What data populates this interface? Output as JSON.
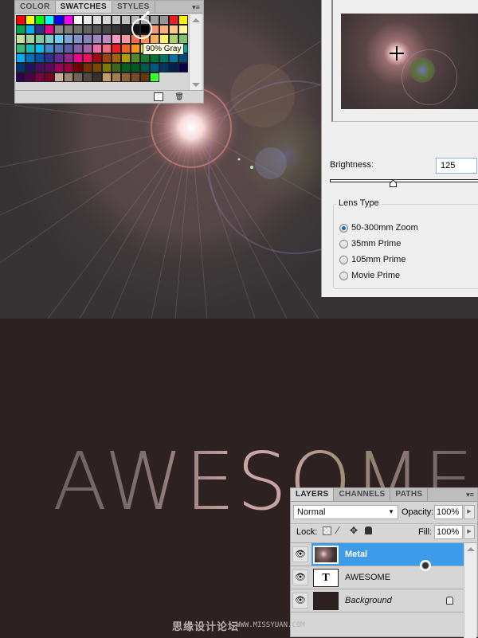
{
  "swatches_panel": {
    "tabs": [
      "COLOR",
      "SWATCHES",
      "STYLES"
    ],
    "active_tab": "SWATCHES",
    "tooltip": "90% Gray",
    "swatch_rows": [
      [
        "#ff0000",
        "#ffff00",
        "#00ff00",
        "#00ffff",
        "#0000ff",
        "#ff00ff",
        "#ffffff",
        "#ebebeb",
        "#e1e1e1",
        "#d7d7d7",
        "#cccccc",
        "#c2c2c2",
        "#b7b7b7",
        "#acacac",
        "#a0a0a0",
        "#959595",
        "#ee1d24",
        "#fff100"
      ],
      [
        "#00a650",
        "#00aeef",
        "#2f3192",
        "#ed008c",
        "#898989",
        "#7d7d7d",
        "#707070",
        "#626262",
        "#555555",
        "#464646",
        "#363636",
        "#262626",
        "#111111",
        "#000000",
        "#f7977a",
        "#fbad82",
        "#fdc68c",
        "#fff799"
      ],
      [
        "#c6df9c",
        "#a4d49d",
        "#81ca9d",
        "#7bcdc9",
        "#6ccff7",
        "#7ca6d8",
        "#8293ca",
        "#8881be",
        "#a286bd",
        "#bc8cbf",
        "#f49bc1",
        "#f5999d",
        "#f16c4d",
        "#f68e54",
        "#fbaf5a",
        "#fff467",
        "#acd372",
        "#7dc473"
      ],
      [
        "#39b778",
        "#16bcb4",
        "#00bff3",
        "#438ccb",
        "#5573b7",
        "#5e5ca7",
        "#855fa8",
        "#a763a9",
        "#ef6ea8",
        "#f16d7e",
        "#ee1d24",
        "#f16522",
        "#f7941d",
        "#fff100",
        "#8fc63d",
        "#37b44a",
        "#00a650",
        "#00a99e"
      ],
      [
        "#00aeef",
        "#0072bc",
        "#0054a5",
        "#2f3192",
        "#652c91",
        "#91278f",
        "#ed008c",
        "#ee105a",
        "#9d0a0f",
        "#a1410d",
        "#a36209",
        "#aba000",
        "#588528",
        "#197b30",
        "#007236",
        "#00736a",
        "#0076a4",
        "#004a80"
      ],
      [
        "#003370",
        "#1d1363",
        "#450e61",
        "#62055f",
        "#9e005c",
        "#9d0039",
        "#790000",
        "#7b3000",
        "#7c4900",
        "#827a00",
        "#3e6617",
        "#045f20",
        "#005824",
        "#005951",
        "#005b7e",
        "#003562",
        "#002056",
        "#0c004b"
      ],
      [
        "#30004a",
        "#4b0048",
        "#7a0045",
        "#7a0026",
        "#c7b299",
        "#998675",
        "#736357",
        "#534741",
        "#37302d",
        "#c69c6d",
        "#a77c50",
        "#8c623b",
        "#754c24",
        "#603913",
        "#3cff2e"
      ]
    ]
  },
  "lens_flare_dialog": {
    "brightness_label": "Brightness:",
    "brightness_value": "125",
    "brightness_fraction": 0.42,
    "lens_type_label": "Lens Type",
    "lens_options": [
      {
        "label": "50-300mm Zoom",
        "checked": true
      },
      {
        "label": "35mm Prime",
        "checked": false
      },
      {
        "label": "105mm Prime",
        "checked": false
      },
      {
        "label": "Movie Prime",
        "checked": false
      }
    ]
  },
  "canvas": {
    "text": "AWESOME",
    "background_color": "#2e2122"
  },
  "layers_panel": {
    "tabs": [
      "LAYERS",
      "CHANNELS",
      "PATHS"
    ],
    "active_tab": "LAYERS",
    "blend_mode": "Normal",
    "opacity_label": "Opacity:",
    "opacity_value": "100%",
    "lock_label": "Lock:",
    "fill_label": "Fill:",
    "fill_value": "100%",
    "layers": [
      {
        "name": "Metal",
        "selected": true,
        "type": "image"
      },
      {
        "name": "AWESOME",
        "selected": false,
        "type": "text",
        "thumb_glyph": "T"
      },
      {
        "name": "Background",
        "selected": false,
        "type": "background",
        "locked": true
      }
    ],
    "selected_color": "#3d9bea"
  },
  "watermark": {
    "cn": "思缘设计论坛",
    "url": "WWW.MISSYUAN.COM"
  }
}
